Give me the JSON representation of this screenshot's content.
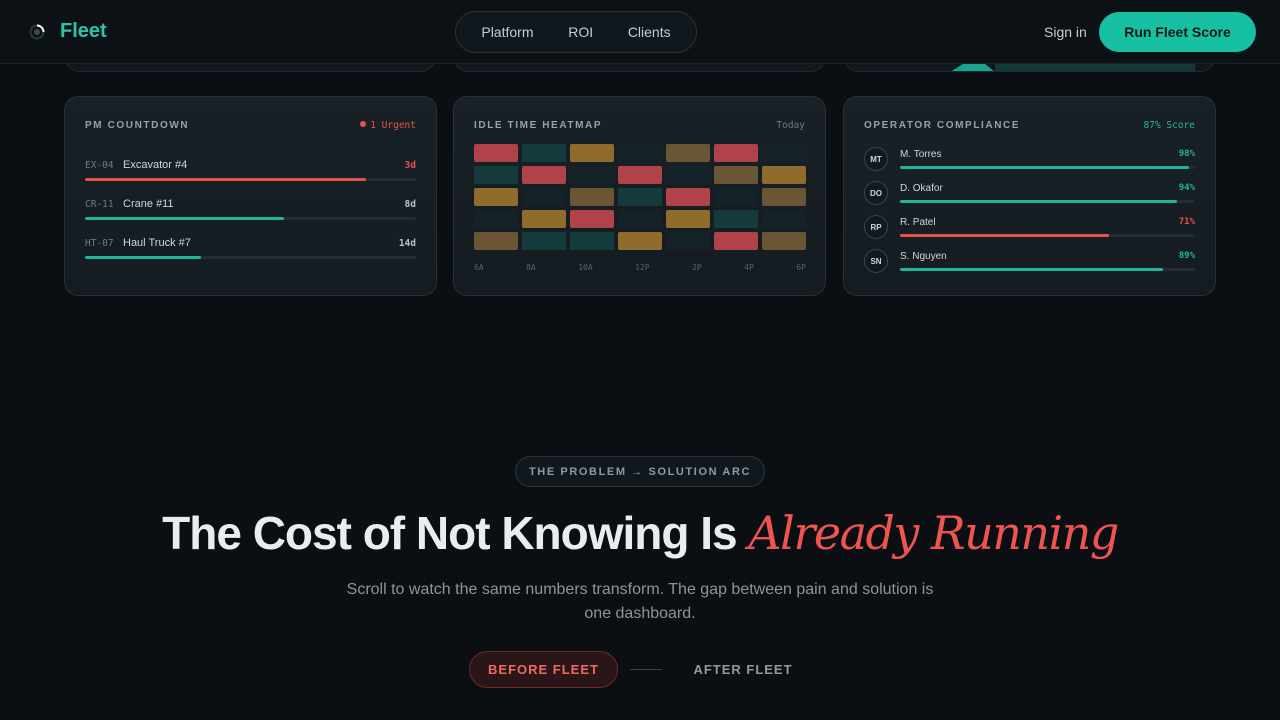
{
  "nav": {
    "brand": "Fleet",
    "links": [
      "Platform",
      "ROI",
      "Clients"
    ],
    "signin": "Sign in",
    "cta": "Run Fleet Score"
  },
  "pm": {
    "title": "PM COUNTDOWN",
    "badge": "1 Urgent",
    "items": [
      {
        "code": "EX-04",
        "name": "Excavator #4",
        "days": "3d",
        "progress": 0.85,
        "color": "#e8504b"
      },
      {
        "code": "CR-11",
        "name": "Crane #11",
        "days": "8d",
        "progress": 0.6,
        "color": "#1fb59b"
      },
      {
        "code": "HT-07",
        "name": "Haul Truck #7",
        "days": "14d",
        "progress": 0.35,
        "color": "#1fb59b"
      }
    ]
  },
  "heatmap": {
    "title": "IDLE TIME HEATMAP",
    "badge": "Today",
    "axis": [
      "6A",
      "8A",
      "10A",
      "12P",
      "2P",
      "4P",
      "6P"
    ],
    "rows": [
      [
        "r",
        "t",
        "y",
        "n",
        "d",
        "r",
        "n"
      ],
      [
        "t",
        "r",
        "n",
        "r",
        "n",
        "d",
        "y"
      ],
      [
        "y",
        "n",
        "d",
        "t",
        "r",
        "n",
        "d"
      ],
      [
        "n",
        "y",
        "r",
        "n",
        "y",
        "t",
        "n"
      ],
      [
        "d",
        "t",
        "t",
        "y",
        "n",
        "r",
        "d"
      ]
    ],
    "colors": {
      "r": "#b0434a",
      "y": "#8f6c2c",
      "d": "#6a5634",
      "t": "#163b3c",
      "n": "#152329"
    }
  },
  "operators": {
    "title": "OPERATOR COMPLIANCE",
    "badge": "87% Score",
    "items": [
      {
        "initials": "MT",
        "name": "M. Torres",
        "score": "98%",
        "value": 0.98,
        "color": "#1fb59b"
      },
      {
        "initials": "DO",
        "name": "D. Okafor",
        "score": "94%",
        "value": 0.94,
        "color": "#1fb59b"
      },
      {
        "initials": "RP",
        "name": "R. Patel",
        "score": "71%",
        "value": 0.71,
        "color": "#e8504b"
      },
      {
        "initials": "SN",
        "name": "S. Nguyen",
        "score": "89%",
        "value": 0.89,
        "color": "#1fb59b"
      }
    ]
  },
  "hero": {
    "eyebrow": "THE PROBLEM → SOLUTION ARC",
    "headline": "The Cost of Not Knowing Is",
    "headline_accent": "Already Running",
    "subtitle": "Scroll to watch the same numbers transform. The gap between pain and solution is one dashboard.",
    "before": "BEFORE FLEET",
    "after": "AFTER FLEET"
  },
  "colors": {
    "accent": "#17c0a2",
    "danger": "#e8504b"
  }
}
